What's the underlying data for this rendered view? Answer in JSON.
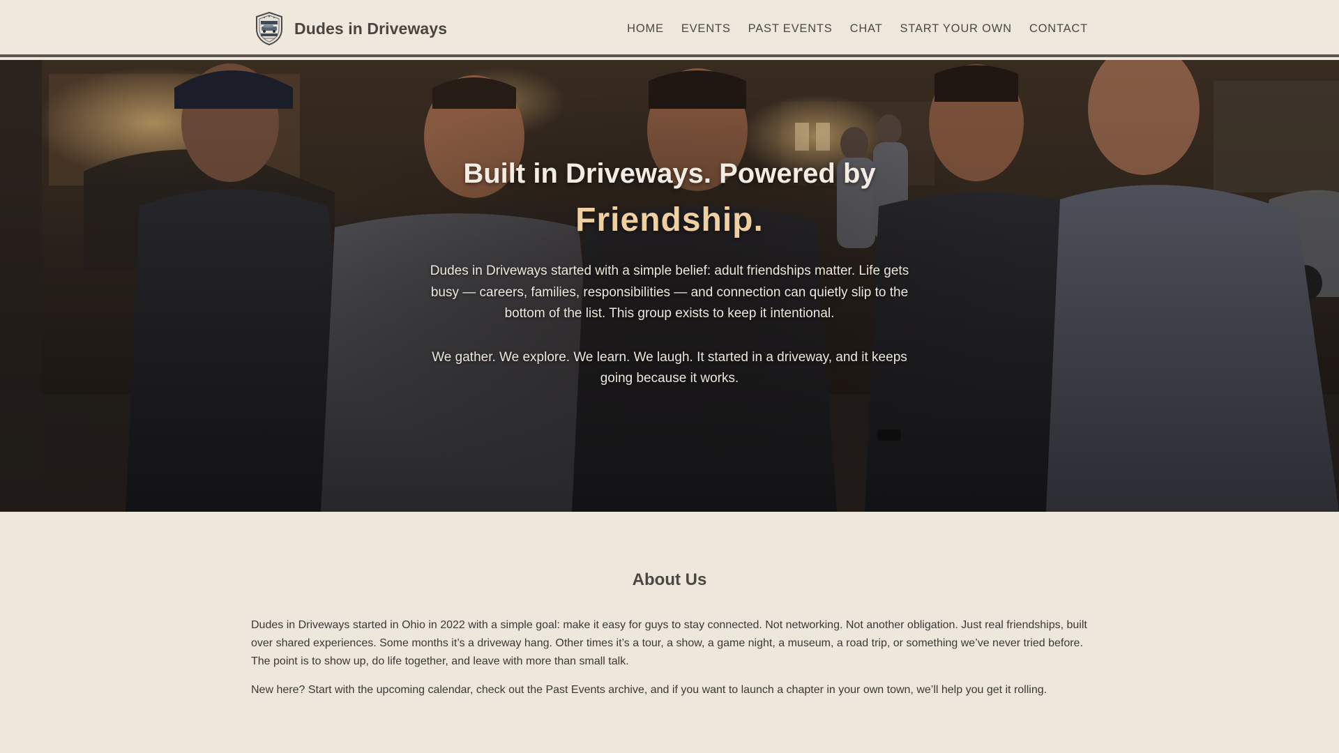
{
  "header": {
    "brand_name": "Dudes in Driveways",
    "logo_icon": "dudes-in-driveways-badge-logo",
    "nav": [
      {
        "label": "HOME"
      },
      {
        "label": "EVENTS"
      },
      {
        "label": "PAST EVENTS"
      },
      {
        "label": "CHAT"
      },
      {
        "label": "START YOUR OWN"
      },
      {
        "label": "CONTACT"
      }
    ]
  },
  "hero": {
    "title_line1": "Built in Driveways. Powered by",
    "title_accent": "Friendship.",
    "paragraph1": "Dudes in Driveways started with a simple belief: adult friendships matter. Life gets busy — careers, families, responsibilities — and connection can quietly slip to the bottom of the list. This group exists to keep it intentional.",
    "paragraph2": "We gather. We explore. We learn. We laugh. It started in a driveway, and it keeps going because it works."
  },
  "about": {
    "title": "About Us",
    "paragraph1": "Dudes in Driveways started in Ohio in 2022 with a simple goal: make it easy for guys to stay connected. Not networking. Not another obligation. Just real friendships, built over shared experiences. Some months it’s a driveway hang. Other times it’s a tour, a show, a game night, a museum, a road trip, or something we’ve never tried before. The point is to show up, do life together, and leave with more than small talk.",
    "paragraph2": "New here? Start with the upcoming calendar, check out the Past Events archive, and if you want to launch a chapter in your own town, we’ll help you get it rolling."
  },
  "colors": {
    "page_bg": "#eee7db",
    "header_border": "#5a5752",
    "accent": "#f0cfa0",
    "text": "#3e3a36"
  }
}
